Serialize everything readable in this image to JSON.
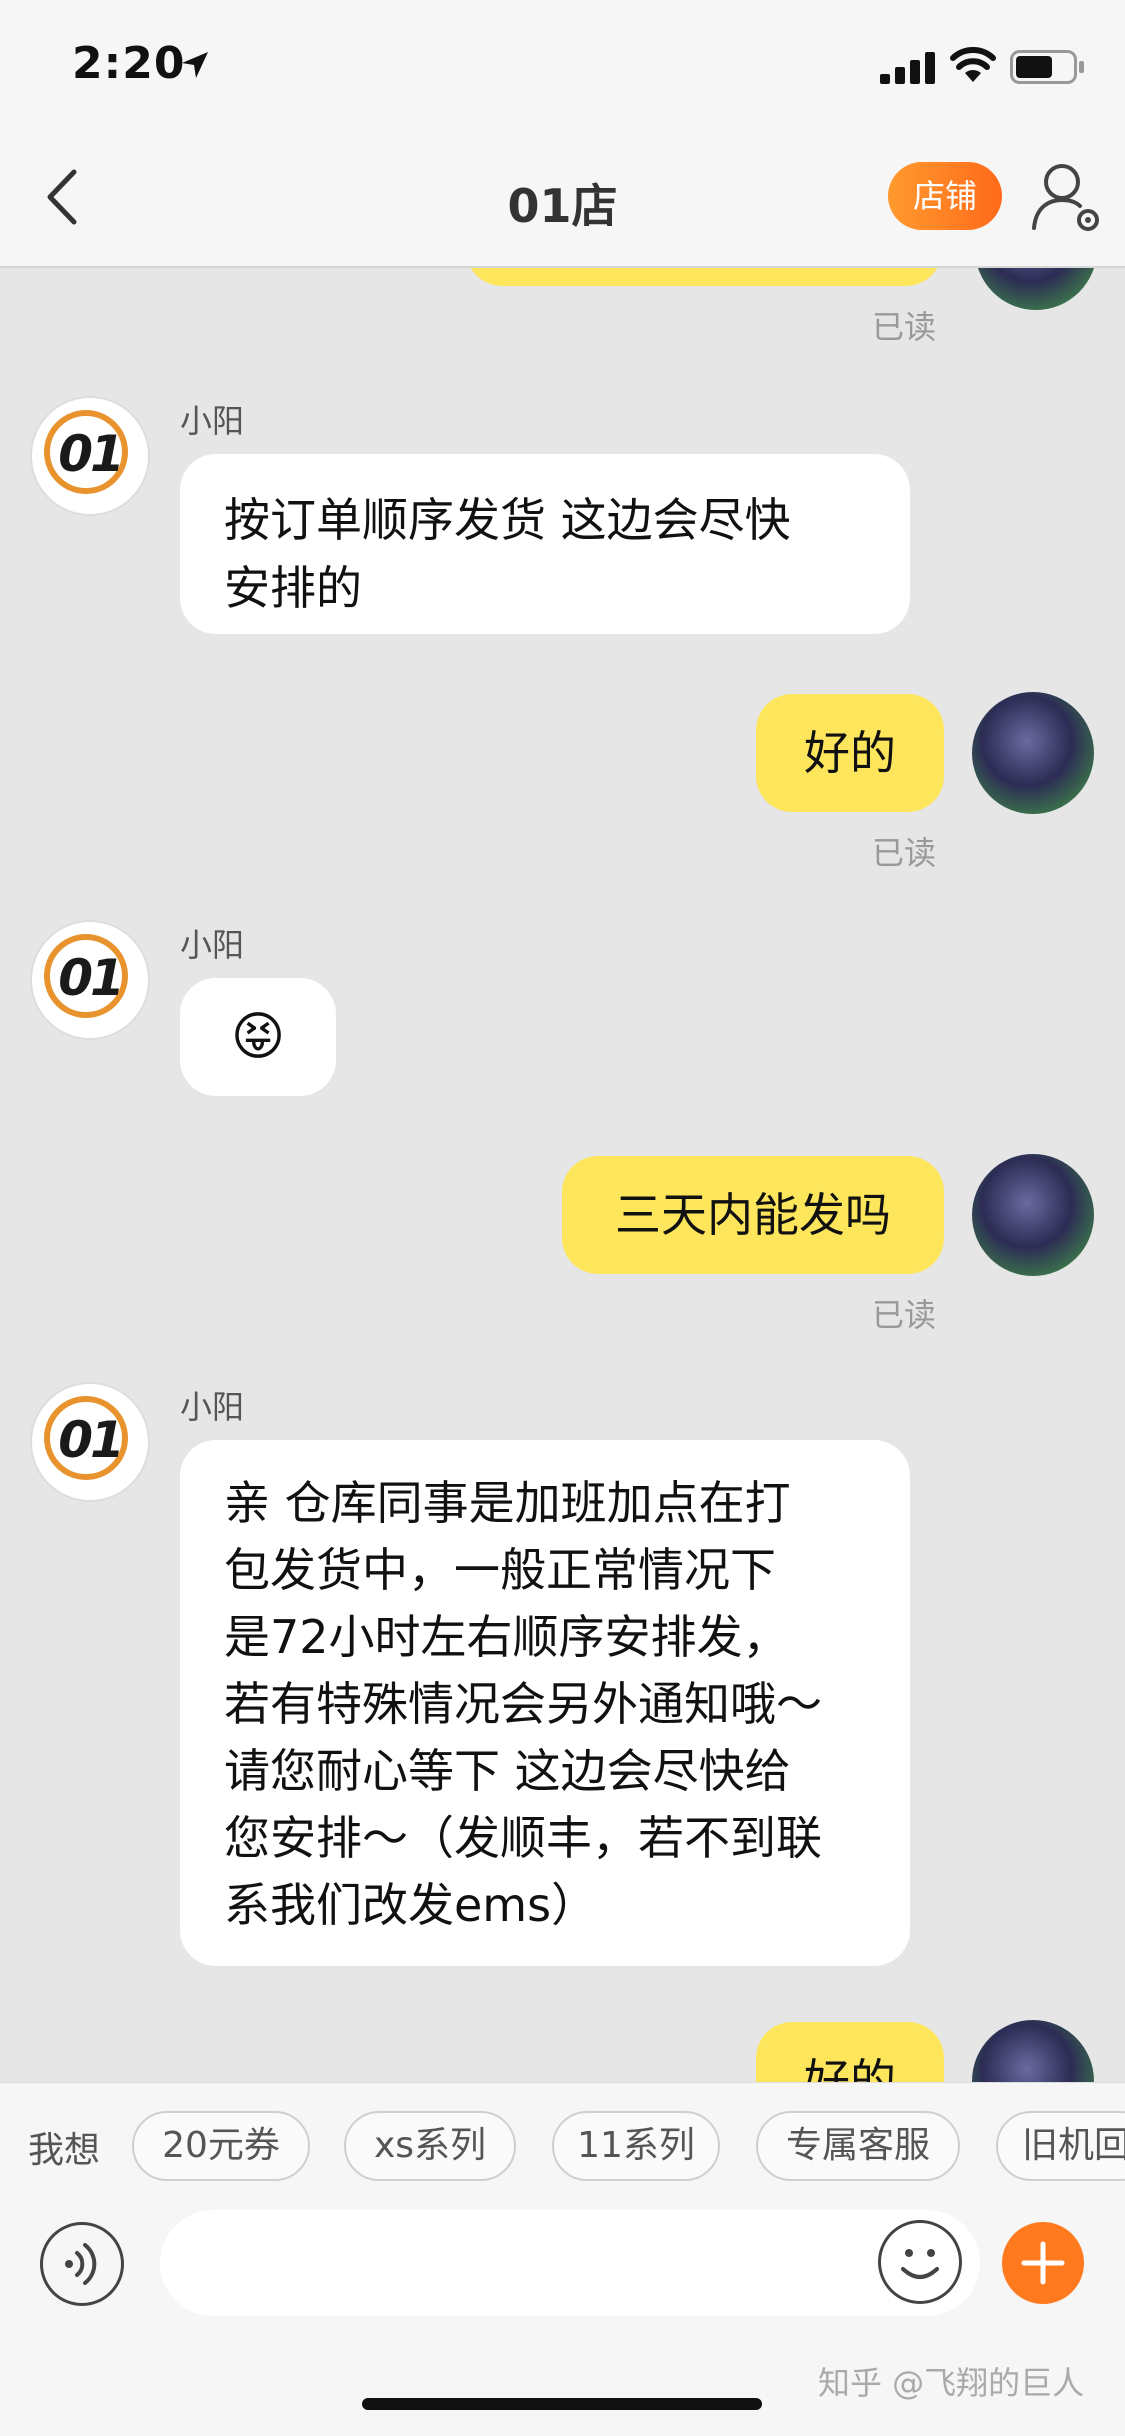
{
  "status_bar": {
    "time": "2:20"
  },
  "nav": {
    "title": "01店",
    "shop_label": "店铺"
  },
  "chat": {
    "shop_avatar_text": "01",
    "read_label": "已读",
    "messages": [
      {
        "side": "right",
        "text": "",
        "read": "已读"
      },
      {
        "side": "left",
        "sender": "小阳",
        "lines": [
          "按订单顺序发货 这边会尽快",
          "安排的"
        ]
      },
      {
        "side": "right",
        "text": "好的",
        "read": "已读"
      },
      {
        "side": "left",
        "sender": "小阳",
        "emoji": "😝"
      },
      {
        "side": "right",
        "text": "三天内能发吗",
        "read": "已读"
      },
      {
        "side": "left",
        "sender": "小阳",
        "lines": [
          "亲 仓库同事是加班加点在打",
          "包发货中，一般正常情况下",
          "是72小时左右顺序安排发，",
          "若有特殊情况会另外通知哦～",
          "请您耐心等下 这边会尽快给",
          "您安排～（发顺丰，若不到联",
          "系我们改发ems）"
        ]
      },
      {
        "side": "right",
        "text": "好的"
      }
    ]
  },
  "quick_replies": {
    "label": "我想",
    "chips": [
      "20元券",
      "xs系列",
      "11系列",
      "专属客服",
      "旧机回"
    ]
  },
  "input": {
    "placeholder": ""
  },
  "watermark": "知乎 @飞翔的巨人",
  "colors": {
    "accent": "#ff7a1f",
    "bubble_right": "#fde65c",
    "bubble_left": "#ffffff"
  }
}
